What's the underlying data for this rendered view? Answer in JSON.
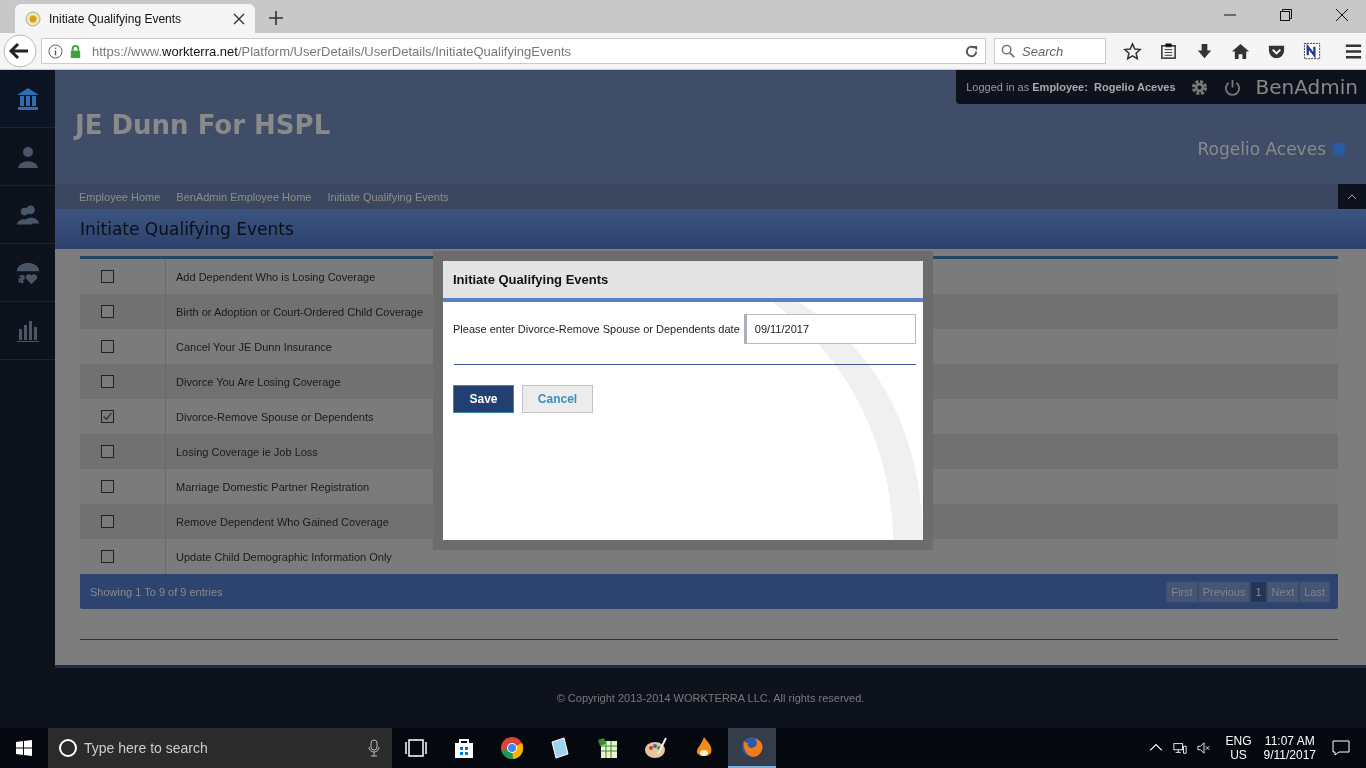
{
  "browser": {
    "tab_title": "Initiate Qualifying Events",
    "url_prefix": "https://www.",
    "url_host": "workterra.net",
    "url_path": "/Platform/UserDetails/UserDetails/InitiateQualifyingEvents",
    "search_placeholder": "Search"
  },
  "top_bar": {
    "logged_in_label": "Logged in as",
    "role": "Employee:",
    "user": "Rogelio Aceves",
    "brand": "BenAdmin"
  },
  "sidebar": {
    "items": [
      {
        "kind": "home",
        "selected": true
      },
      {
        "kind": "person",
        "selected": false
      },
      {
        "kind": "people",
        "selected": false
      },
      {
        "kind": "umbrella",
        "selected": false
      },
      {
        "kind": "chart",
        "selected": false
      }
    ]
  },
  "header": {
    "company": "JE Dunn For HSPL",
    "user_name": "Rogelio Aceves"
  },
  "breadcrumbs": [
    "Employee Home",
    "BenAdmin Employee Home",
    "Initiate Qualifying Events"
  ],
  "page_title": "Initiate Qualifying Events",
  "events": [
    {
      "label": "Add Dependent Who is Losing Coverage",
      "checked": false
    },
    {
      "label": "Birth or Adoption or Court-Ordered Child Coverage",
      "checked": false
    },
    {
      "label": "Cancel Your JE Dunn Insurance",
      "checked": false
    },
    {
      "label": "Divorce You Are Losing Coverage",
      "checked": false
    },
    {
      "label": "Divorce-Remove Spouse or Dependents",
      "checked": true
    },
    {
      "label": "Losing Coverage ie Job Loss",
      "checked": false
    },
    {
      "label": "Marriage Domestic Partner Registration",
      "checked": false
    },
    {
      "label": "Remove Dependent Who Gained Coverage",
      "checked": false
    },
    {
      "label": "Update Child Demographic Information Only",
      "checked": false
    }
  ],
  "table_footer": {
    "info": "Showing 1 To 9 of 9 entries",
    "pages": [
      {
        "label": "First",
        "selected": false
      },
      {
        "label": "Previous",
        "selected": false
      },
      {
        "label": "1",
        "selected": true
      },
      {
        "label": "Next",
        "selected": false
      },
      {
        "label": "Last",
        "selected": false
      }
    ]
  },
  "modal": {
    "title": "Initiate Qualifying Events",
    "label": "Please enter Divorce-Remove Spouse or Dependents date",
    "date_value": "09/11/2017",
    "save": "Save",
    "cancel": "Cancel"
  },
  "footer": {
    "copyright": "© Copyright 2013-2014 WORKTERRA LLC. All rights reserved."
  },
  "taskbar": {
    "search_placeholder": "Type here to search",
    "apps": [
      {
        "kind": "task-view",
        "active": false
      },
      {
        "kind": "store",
        "active": false
      },
      {
        "kind": "chrome",
        "active": false
      },
      {
        "kind": "notepad",
        "active": false
      },
      {
        "kind": "spreadsheet",
        "active": false
      },
      {
        "kind": "paint",
        "active": false
      },
      {
        "kind": "flame",
        "active": false
      },
      {
        "kind": "firefox",
        "active": true
      }
    ],
    "language": "ENG",
    "region": "US",
    "time": "11:07 AM",
    "date": "9/11/2017"
  }
}
